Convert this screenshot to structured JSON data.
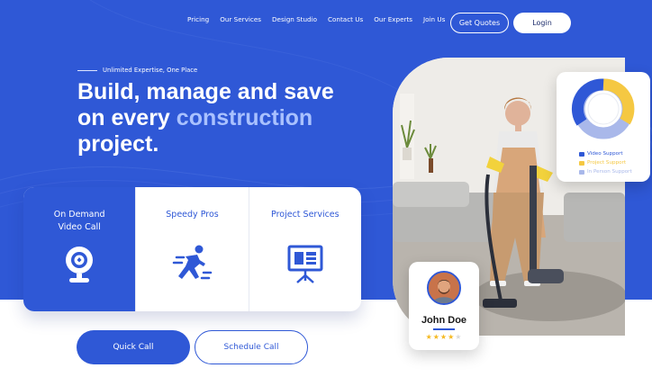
{
  "nav": {
    "items": [
      "Pricing",
      "Our Services",
      "Design Studio",
      "Contact Us",
      "Our Experts",
      "Join Us"
    ],
    "get_quotes": "Get Quotes",
    "login": "Login"
  },
  "hero": {
    "tagline": "Unlimited Expertise, One Place",
    "headline_part1": "Build, manage and save",
    "headline_part2": "on every",
    "headline_accent": "construction",
    "headline_part3": "project."
  },
  "services": [
    {
      "label_line1": "On Demand",
      "label_line2": "Video Call",
      "icon": "webcam-icon",
      "active": true
    },
    {
      "label_line1": "Speedy Pros",
      "label_line2": "",
      "icon": "running-person-icon",
      "active": false
    },
    {
      "label_line1": "Project Services",
      "label_line2": "",
      "icon": "presentation-board-icon",
      "active": false
    }
  ],
  "actions": {
    "quick_call": "Quick Call",
    "schedule_call": "Schedule Call"
  },
  "support_chart": {
    "legend": [
      {
        "label": "Video Support",
        "color": "#2f58d6"
      },
      {
        "label": "Project Support",
        "color": "#f5c842"
      },
      {
        "label": "In Person Support",
        "color": "#a9b8ea"
      }
    ]
  },
  "profile": {
    "name": "John Doe",
    "rating": 4,
    "rating_max": 5
  },
  "colors": {
    "brand_blue": "#2f58d6",
    "accent_light_blue": "#a9c1ff",
    "star_gold": "#f5b921"
  }
}
